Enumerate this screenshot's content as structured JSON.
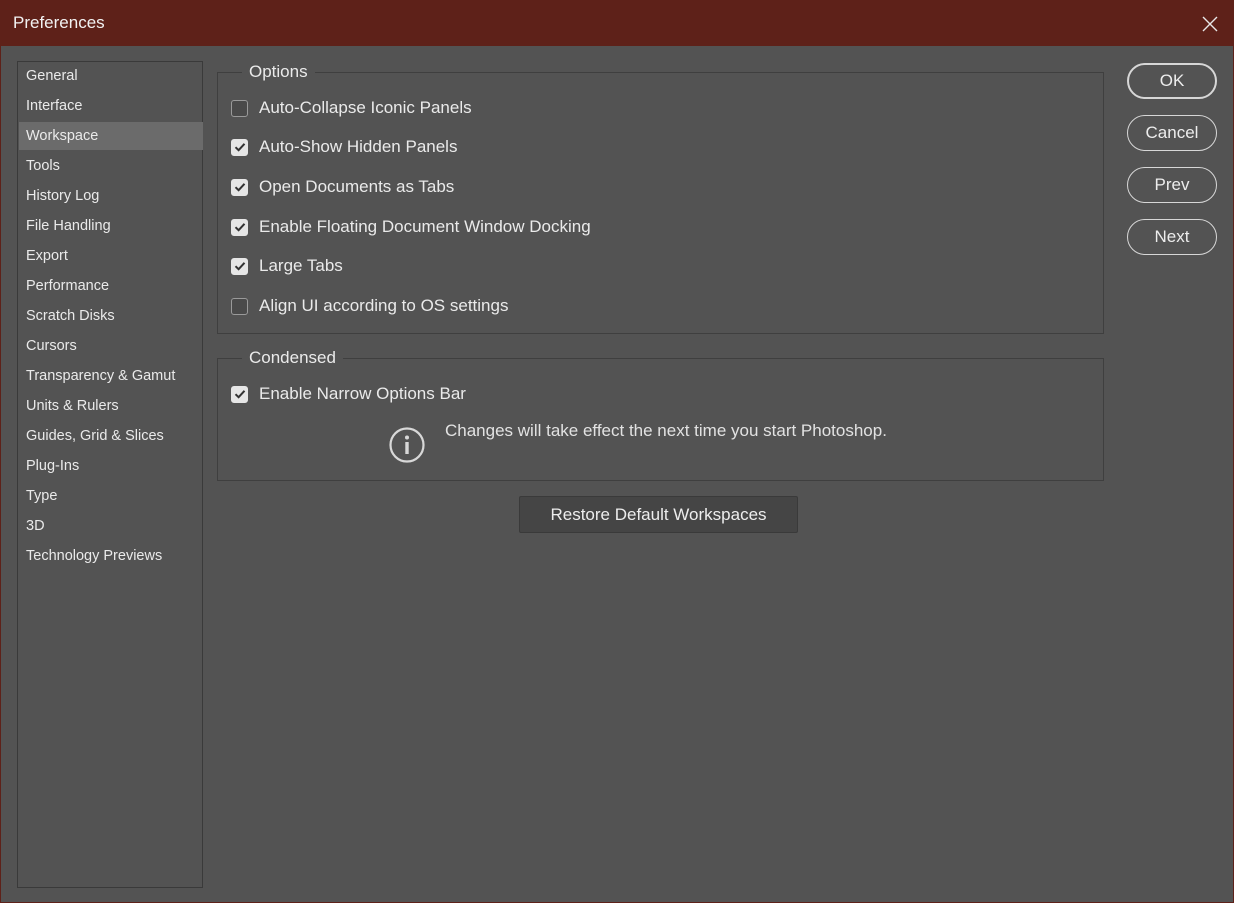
{
  "window": {
    "title": "Preferences",
    "close_icon": "close-icon"
  },
  "sidebar": {
    "selected": "Workspace",
    "items": [
      {
        "label": "General"
      },
      {
        "label": "Interface"
      },
      {
        "label": "Workspace"
      },
      {
        "label": "Tools"
      },
      {
        "label": "History Log"
      },
      {
        "label": "File Handling"
      },
      {
        "label": "Export"
      },
      {
        "label": "Performance"
      },
      {
        "label": "Scratch Disks"
      },
      {
        "label": "Cursors"
      },
      {
        "label": "Transparency & Gamut"
      },
      {
        "label": "Units & Rulers"
      },
      {
        "label": "Guides, Grid & Slices"
      },
      {
        "label": "Plug-Ins"
      },
      {
        "label": "Type"
      },
      {
        "label": "3D"
      },
      {
        "label": "Technology Previews"
      }
    ]
  },
  "options": {
    "title": "Options",
    "items": [
      {
        "label": "Auto-Collapse Iconic Panels",
        "checked": false
      },
      {
        "label": "Auto-Show Hidden Panels",
        "checked": true
      },
      {
        "label": "Open Documents as Tabs",
        "checked": true
      },
      {
        "label": "Enable Floating Document Window Docking",
        "checked": true
      },
      {
        "label": "Large Tabs",
        "checked": true
      },
      {
        "label": "Align UI according to OS settings",
        "checked": false
      }
    ]
  },
  "condensed": {
    "title": "Condensed",
    "items": [
      {
        "label": "Enable Narrow Options Bar",
        "checked": true
      }
    ],
    "info_icon": "info-icon",
    "info_text": "Changes will take effect the next time you start Photoshop."
  },
  "restore_button": {
    "label": "Restore Default Workspaces"
  },
  "buttons": {
    "ok": "OK",
    "cancel": "Cancel",
    "prev": "Prev",
    "next": "Next"
  },
  "colors": {
    "titlebar": "#5e2119",
    "background": "#535353",
    "selected_item": "#6b6b6b"
  }
}
